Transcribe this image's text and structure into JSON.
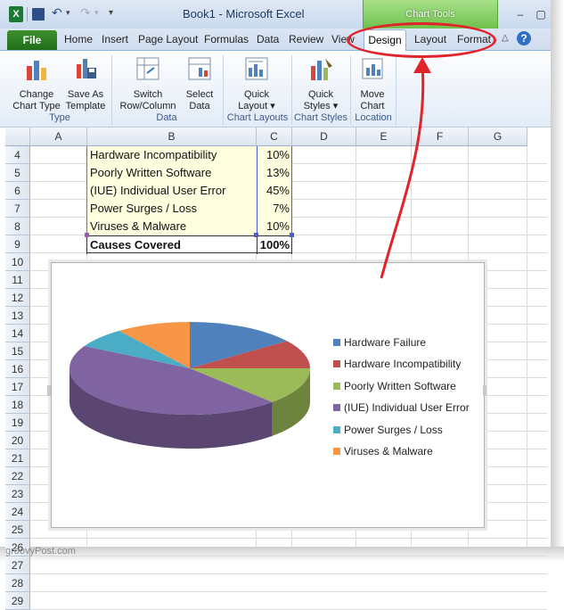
{
  "window": {
    "title": "Book1 - Microsoft Excel",
    "contextual_group": "Chart Tools"
  },
  "tabs": {
    "file": "File",
    "items": [
      "Home",
      "Insert",
      "Page Layout",
      "Formulas",
      "Data",
      "Review",
      "View"
    ],
    "design": "Design",
    "layout": "Layout",
    "format": "Format"
  },
  "ribbon": {
    "change_chart_type": "Change\nChart Type",
    "save_as_template": "Save As\nTemplate",
    "group_type": "Type",
    "switch_row_column": "Switch\nRow/Column",
    "select_data": "Select\nData",
    "group_data": "Data",
    "quick_layout": "Quick\nLayout ▾",
    "group_chart_layouts": "Chart Layouts",
    "quick_styles": "Quick\nStyles ▾",
    "group_chart_styles": "Chart Styles",
    "move_chart": "Move\nChart",
    "group_location": "Location"
  },
  "grid": {
    "columns": [
      "A",
      "B",
      "C",
      "D",
      "E",
      "F",
      "G"
    ],
    "rows": [
      "4",
      "5",
      "6",
      "7",
      "8",
      "9",
      "10",
      "11",
      "12",
      "13",
      "14",
      "15",
      "16",
      "17",
      "18",
      "19",
      "20",
      "21",
      "22",
      "23",
      "24",
      "25",
      "26",
      "27",
      "28",
      "29"
    ],
    "cells": [
      {
        "b": "Hardware Incompatibility",
        "c": "10%"
      },
      {
        "b": "Poorly Written Software",
        "c": "13%"
      },
      {
        "b": "(IUE) Individual User Error",
        "c": "45%"
      },
      {
        "b": "Power Surges / Loss",
        "c": "7%"
      },
      {
        "b": "Viruses & Malware",
        "c": "10%"
      },
      {
        "b": "Causes Covered",
        "c": "100%"
      }
    ]
  },
  "chart_data": {
    "type": "pie",
    "title": "",
    "categories": [
      "Hardware Failure",
      "Hardware Incompatibility",
      "Poorly Written Software",
      "(IUE) Individual User Error",
      "Power Surges / Loss",
      "Viruses & Malware"
    ],
    "values": [
      15,
      10,
      13,
      45,
      7,
      10
    ],
    "colors": [
      "#4f81bd",
      "#c0504d",
      "#9bbb59",
      "#8064a2",
      "#4bacc6",
      "#f79646"
    ],
    "legend": "right"
  },
  "watermark": "groovyPost.com"
}
